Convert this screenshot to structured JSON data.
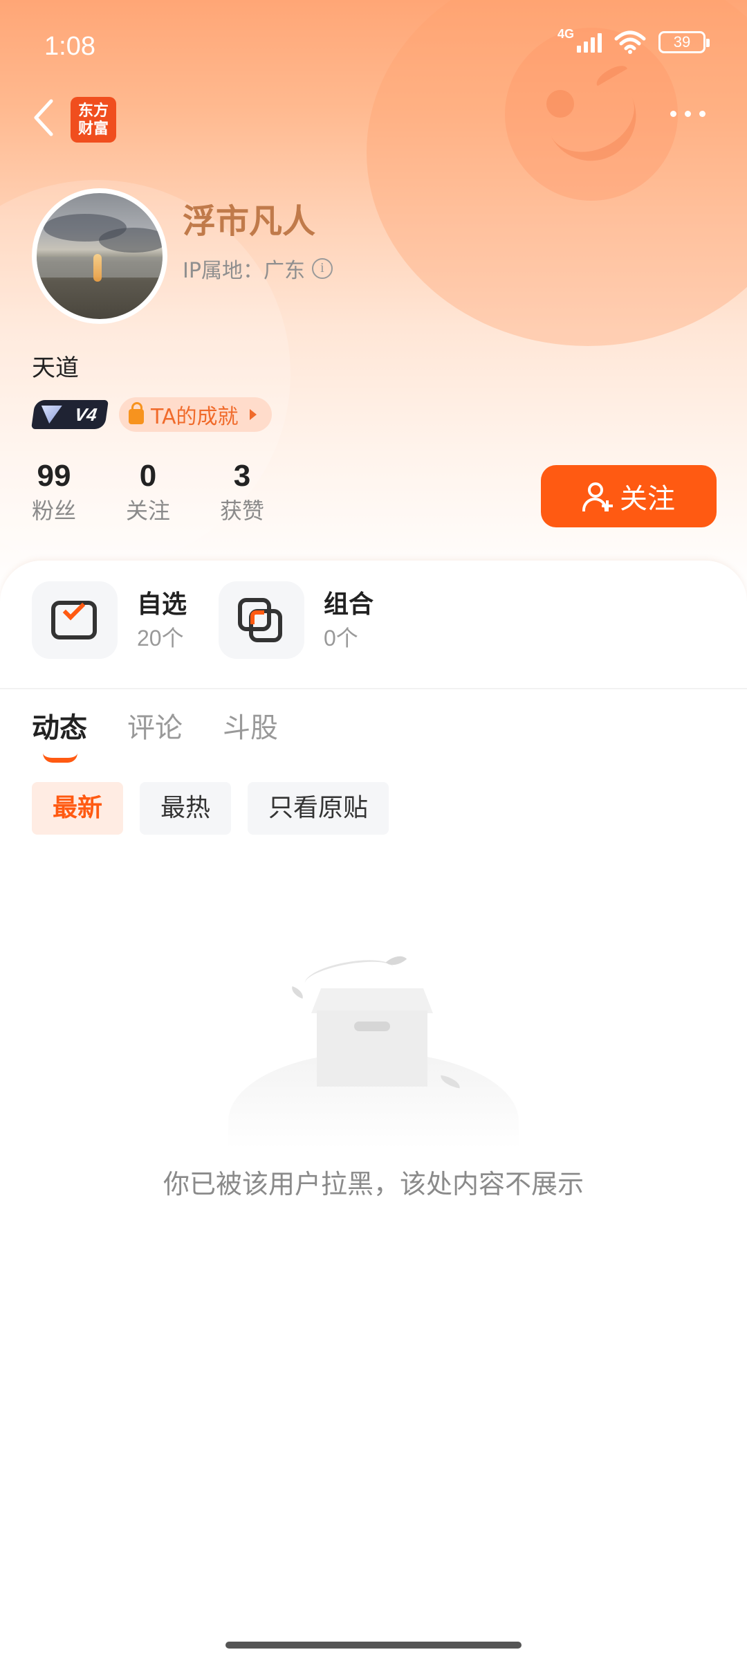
{
  "status_bar": {
    "time": "1:08",
    "network": "4G",
    "battery": "39"
  },
  "nav": {
    "logo_line1": "东方",
    "logo_line2": "财富"
  },
  "profile": {
    "username": "浮市凡人",
    "ip_location": "IP属地：广东",
    "bio": "天道",
    "vip_level": "V4",
    "achievement_label": "TA的成就"
  },
  "stats": [
    {
      "value": "99",
      "label": "粉丝"
    },
    {
      "value": "0",
      "label": "关注"
    },
    {
      "value": "3",
      "label": "获赞"
    }
  ],
  "follow_button": "关注",
  "quick_entries": [
    {
      "title": "自选",
      "count": "20个"
    },
    {
      "title": "组合",
      "count": "0个"
    }
  ],
  "tabs": [
    {
      "label": "动态",
      "active": true
    },
    {
      "label": "评论",
      "active": false
    },
    {
      "label": "斗股",
      "active": false
    }
  ],
  "filters": [
    {
      "label": "最新",
      "active": true
    },
    {
      "label": "最热",
      "active": false
    },
    {
      "label": "只看原贴",
      "active": false
    }
  ],
  "empty_state": {
    "message": "你已被该用户拉黑，该处内容不展示"
  },
  "colors": {
    "accent": "#ff5a12",
    "username": "#c07a4a",
    "header_top": "#ffa676"
  }
}
